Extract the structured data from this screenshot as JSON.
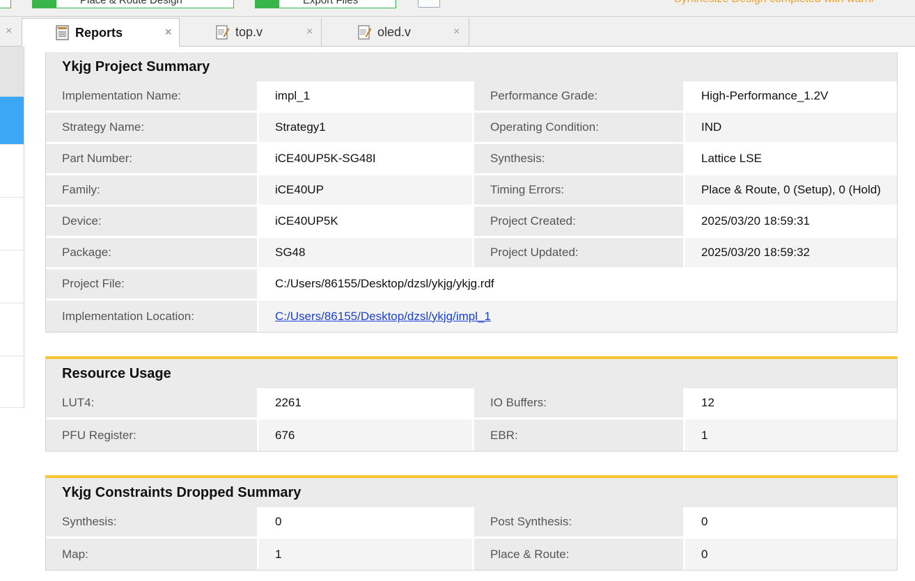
{
  "toolbar": {
    "place_route_label": "Place & Route Design",
    "export_files_label": "Export Files",
    "status_text": "Synthesize Design completed with warni"
  },
  "tabs": [
    {
      "label": "Reports",
      "icon": "report-icon",
      "close": "×"
    },
    {
      "label": "top.v",
      "icon": "verilog-file-icon",
      "close": "×"
    },
    {
      "label": "oled.v",
      "icon": "verilog-file-icon",
      "close": "×"
    }
  ],
  "left_close": "×",
  "project_summary": {
    "title": "Ykjg Project Summary",
    "rows": [
      {
        "l1": "Implementation Name:",
        "v1": "impl_1",
        "l2": "Performance Grade:",
        "v2": "High-Performance_1.2V"
      },
      {
        "l1": "Strategy Name:",
        "v1": "Strategy1",
        "l2": "Operating Condition:",
        "v2": "IND"
      },
      {
        "l1": "Part Number:",
        "v1": "iCE40UP5K-SG48I",
        "l2": "Synthesis:",
        "v2": "Lattice LSE"
      },
      {
        "l1": "Family:",
        "v1": "iCE40UP",
        "l2": "Timing Errors:",
        "v2": "Place & Route, 0 (Setup), 0 (Hold)"
      },
      {
        "l1": "Device:",
        "v1": "iCE40UP5K",
        "l2": "Project Created:",
        "v2": "2025/03/20 18:59:31"
      },
      {
        "l1": "Package:",
        "v1": "SG48",
        "l2": "Project Updated:",
        "v2": "2025/03/20 18:59:32"
      }
    ],
    "project_file_label": "Project File:",
    "project_file_value": "C:/Users/86155/Desktop/dzsl/ykjg/ykjg.rdf",
    "impl_location_label": "Implementation Location:",
    "impl_location_value": "C:/Users/86155/Desktop/dzsl/ykjg/impl_1"
  },
  "resource_usage": {
    "title": "Resource Usage",
    "rows": [
      {
        "l1": "LUT4:",
        "v1": "2261",
        "l2": "IO Buffers:",
        "v2": "12"
      },
      {
        "l1": "PFU Register:",
        "v1": "676",
        "l2": "EBR:",
        "v2": "1"
      }
    ]
  },
  "constraints_dropped": {
    "title": "Ykjg Constraints Dropped Summary",
    "rows": [
      {
        "l1": "Synthesis:",
        "v1": "0",
        "l2": "Post Synthesis:",
        "v2": "0"
      },
      {
        "l1": "Map:",
        "v1": "1",
        "l2": "Place & Route:",
        "v2": "0"
      }
    ]
  },
  "colors": {
    "accent": "#f6c531",
    "link": "#1a3fd6",
    "status": "#f0a020",
    "left_selected": "#3ba7f5"
  }
}
